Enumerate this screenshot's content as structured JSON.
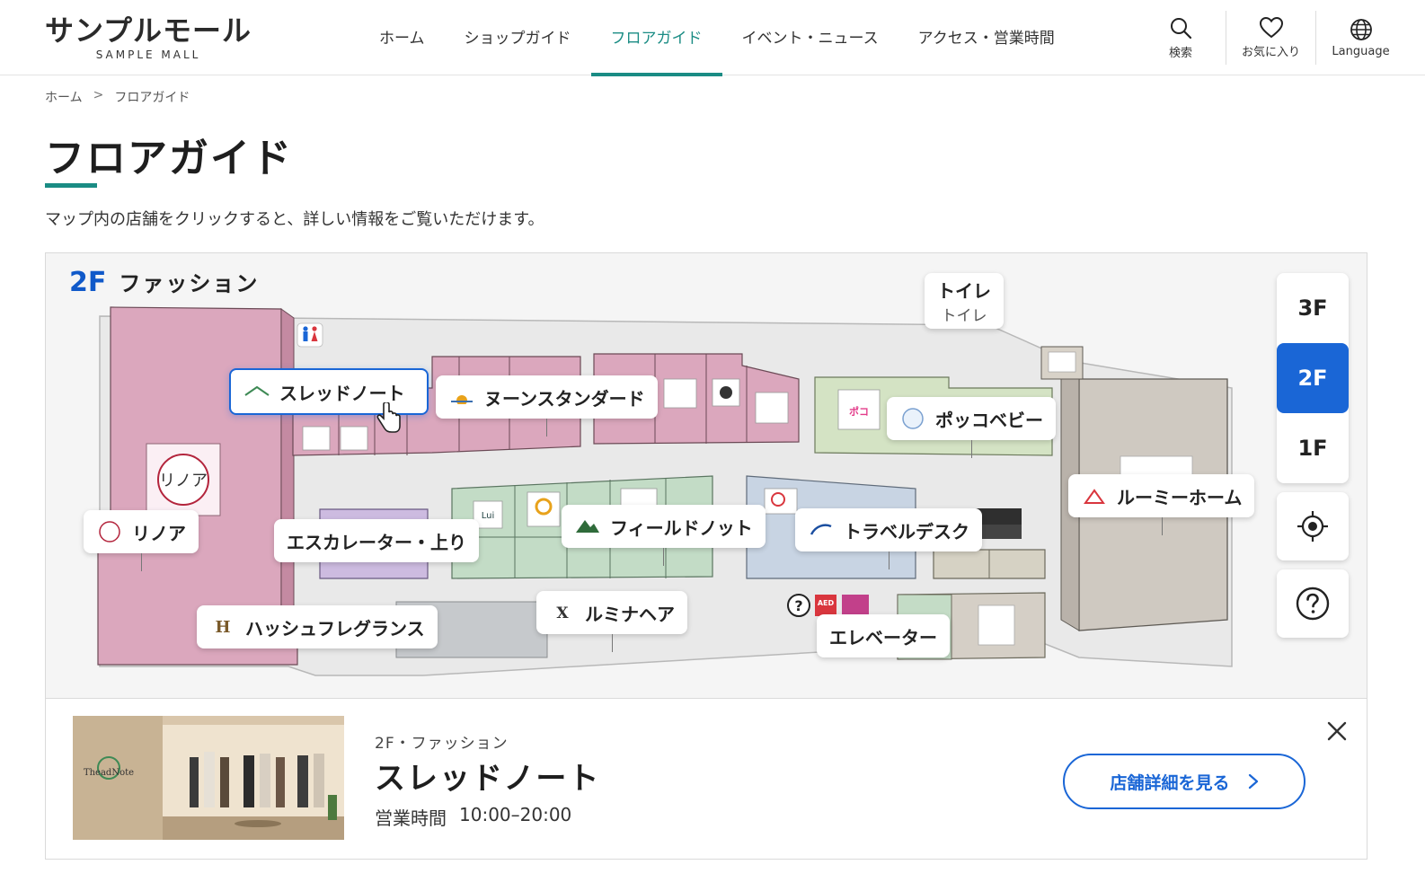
{
  "header": {
    "logo_ja": "サンプルモール",
    "logo_en": "SAMPLE MALL",
    "nav": [
      {
        "label": "ホーム"
      },
      {
        "label": "ショップガイド"
      },
      {
        "label": "フロアガイド"
      },
      {
        "label": "イベント・ニュース"
      },
      {
        "label": "アクセス・営業時間"
      }
    ],
    "active_nav": "フロアガイド",
    "tools": {
      "search": "検索",
      "favorites": "お気に入り",
      "language": "Language"
    }
  },
  "breadcrumb": {
    "home": "ホーム",
    "sep": ">",
    "current": "フロアガイド"
  },
  "page": {
    "title": "フロアガイド",
    "lead": "マップ内の店舗をクリックすると、詳しい情報をご覧いただけます。"
  },
  "map": {
    "floor_num": "2F",
    "floor_name": "ファッション",
    "tags": {
      "toilet": "トイレ",
      "toilet_sub": "トイレ",
      "thread": "スレッドノート",
      "noon": "ヌーンスタンダード",
      "pocco": "ポッコベビー",
      "rinoa": "リノア",
      "escalator": "エスカレーター・上り",
      "field": "フィールドノット",
      "travel": "トラベルデスク",
      "roomy": "ルーミーホーム",
      "hash": "ハッシュフレグランス",
      "lumina": "ルミナヘア",
      "elevator": "エレベーター"
    },
    "sign_logo": "リノア",
    "floors": [
      "3F",
      "2F",
      "1F"
    ],
    "active_floor": "2F"
  },
  "info": {
    "category": "2F・ファッション",
    "name": "スレッドノート",
    "hours_label": "営業時間",
    "hours": "10:00–20:00",
    "detail_button": "店舗詳細を見る",
    "thumb_logo": "TheadNote"
  },
  "colors": {
    "accent_teal": "#1a8c84",
    "accent_blue": "#1a66d6",
    "fashion_pink": "#dba7bd",
    "green": "#c3dcc6",
    "purple": "#cdbbe0",
    "blue_gray": "#c8d4e3"
  }
}
